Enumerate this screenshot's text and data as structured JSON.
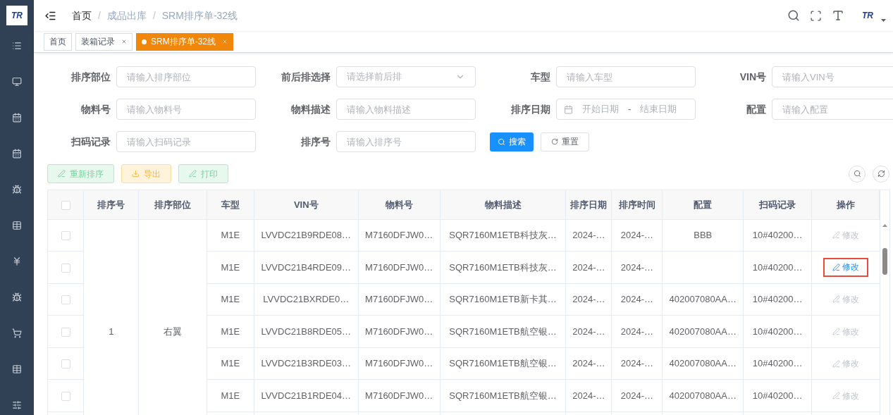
{
  "logo": {
    "text": "TR"
  },
  "user_logo": {
    "text": "TR"
  },
  "breadcrumb": [
    "首页",
    "成品出库",
    "SRM排序单-32线"
  ],
  "breadcrumb_separator": "/",
  "tabs": [
    {
      "label": "首页",
      "selected": false,
      "closable": false
    },
    {
      "label": "装箱记录",
      "selected": false,
      "closable": true
    },
    {
      "label": "SRM排序单-32线",
      "selected": true,
      "closable": true
    }
  ],
  "filters": [
    {
      "label": "排序部位",
      "kind": "input",
      "placeholder": "请输入排序部位"
    },
    {
      "label": "前后排选择",
      "kind": "select",
      "placeholder": "请选择前后排"
    },
    {
      "label": "车型",
      "kind": "input",
      "placeholder": "请输入车型"
    },
    {
      "label": "VIN号",
      "kind": "input",
      "placeholder": "请输入VIN号"
    },
    {
      "label": "物料号",
      "kind": "input",
      "placeholder": "请输入物料号"
    },
    {
      "label": "物料描述",
      "kind": "input",
      "placeholder": "请输入物料描述"
    },
    {
      "label": "排序日期",
      "kind": "daterange",
      "start_placeholder": "开始日期",
      "separator": "-",
      "end_placeholder": "结束日期"
    },
    {
      "label": "配置",
      "kind": "input",
      "placeholder": "请输入配置"
    },
    {
      "label": "扫码记录",
      "kind": "input",
      "placeholder": "请输入扫码记录"
    },
    {
      "label": "排序号",
      "kind": "input",
      "placeholder": "请输入排序号"
    }
  ],
  "search_button": "搜索",
  "reset_button": "重置",
  "actions": [
    {
      "label": "重新排序",
      "kind": "success"
    },
    {
      "label": "导出",
      "kind": "warning"
    },
    {
      "label": "打印",
      "kind": "success"
    }
  ],
  "table": {
    "select_all_checked": false,
    "columns": [
      "排序号",
      "排序部位",
      "车型",
      "VIN号",
      "物料号",
      "物料描述",
      "排序日期",
      "排序时间",
      "配置",
      "扫码记录",
      "操作"
    ],
    "group": {
      "sort_no": "1",
      "part": "右翼"
    },
    "rows": [
      {
        "checked": false,
        "car_model": "M1E",
        "vin": "LVVDC21B9RDE08…",
        "material_no": "M7160DFJW0…",
        "material_desc": "SQR7160M1ETB科技灰…",
        "sort_date": "2024-…",
        "sort_time": "2024-…",
        "config": "BBB",
        "scan_record": "10#40200…",
        "action": {
          "label": "修改",
          "disabled": true,
          "highlighted": false
        }
      },
      {
        "checked": false,
        "car_model": "M1E",
        "vin": "LVVDC21B4RDE09…",
        "material_no": "M7160DFJW0…",
        "material_desc": "SQR7160M1ETB科技灰…",
        "sort_date": "2024-…",
        "sort_time": "2024-…",
        "scan_record": "10#40200…",
        "action": {
          "label": "修改",
          "disabled": false,
          "highlighted": true
        }
      },
      {
        "checked": false,
        "car_model": "M1E",
        "vin": "LVVDC21BXRDE0…",
        "material_no": "M7160DFJW0…",
        "material_desc": "SQR7160M1ETB新卡其…",
        "sort_date": "2024-…",
        "sort_time": "2024-…",
        "config": "402007080AA…",
        "scan_record": "10#40200…",
        "action": {
          "label": "修改",
          "disabled": true,
          "highlighted": false
        }
      },
      {
        "checked": false,
        "car_model": "M1E",
        "vin": "LVVDC21B8RDE05…",
        "material_no": "M7160DFJW0…",
        "material_desc": "SQR7160M1ETB航空银…",
        "sort_date": "2024-…",
        "sort_time": "2024-…",
        "config": "402007080AA…",
        "scan_record": "10#40200…",
        "action": {
          "label": "修改",
          "disabled": true,
          "highlighted": false
        }
      },
      {
        "checked": false,
        "car_model": "M1E",
        "vin": "LVVDC21B3RDE03…",
        "material_no": "M7160DFJW0…",
        "material_desc": "SQR7160M1ETB航空银…",
        "sort_date": "2024-…",
        "sort_time": "2024-…",
        "config": "402007080AA…",
        "scan_record": "10#40200…",
        "action": {
          "label": "修改",
          "disabled": true,
          "highlighted": false
        }
      },
      {
        "checked": false,
        "car_model": "M1E",
        "vin": "LVVDC21B1RDE04…",
        "material_no": "M7160DFJW0…",
        "material_desc": "SQR7160M1ETB航空银…",
        "sort_date": "2024-…",
        "sort_time": "2024-…",
        "config": "402007080AA…",
        "scan_record": "10#40200…",
        "action": {
          "label": "修改",
          "disabled": true,
          "highlighted": false
        }
      }
    ]
  }
}
